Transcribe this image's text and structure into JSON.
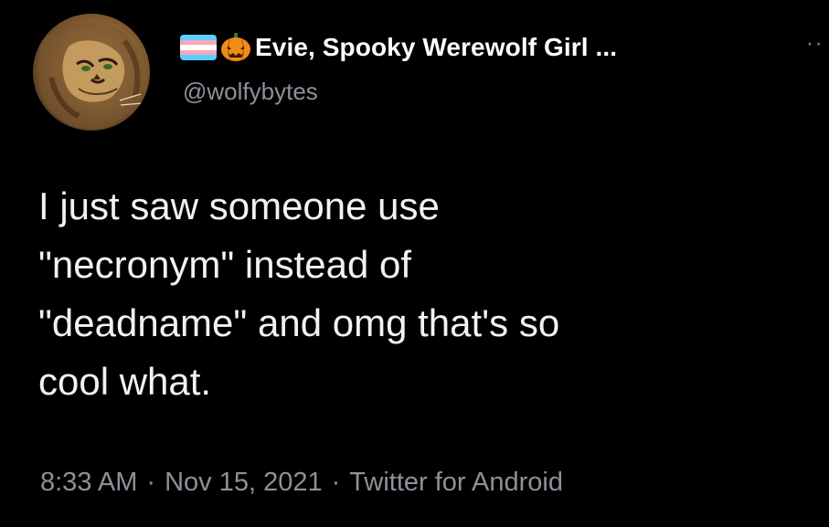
{
  "tweet": {
    "display_name": "Evie, Spooky Werewolf Girl ...",
    "handle": "@wolfybytes",
    "text": "I just saw someone use\n\"necronym\" instead of\n\"deadname\" and omg that's so\ncool what.",
    "time": "8:33 AM",
    "date": "Nov 15, 2021",
    "source": "Twitter for Android",
    "separator": "·",
    "more_label": "··"
  },
  "icons": {
    "avatar": "lion-avatar",
    "flag": "trans-flag-emoji",
    "pumpkin": "jack-o-lantern-emoji",
    "more": "more-options-icon"
  },
  "colors": {
    "background": "#000000",
    "name": "#ffffff",
    "secondary": "#8b9299",
    "text": "#f0f2f3",
    "flag_blue": "#5bcefa",
    "flag_pink": "#f5a9b8",
    "flag_white": "#ffffff",
    "pumpkin": "#f28c18"
  }
}
